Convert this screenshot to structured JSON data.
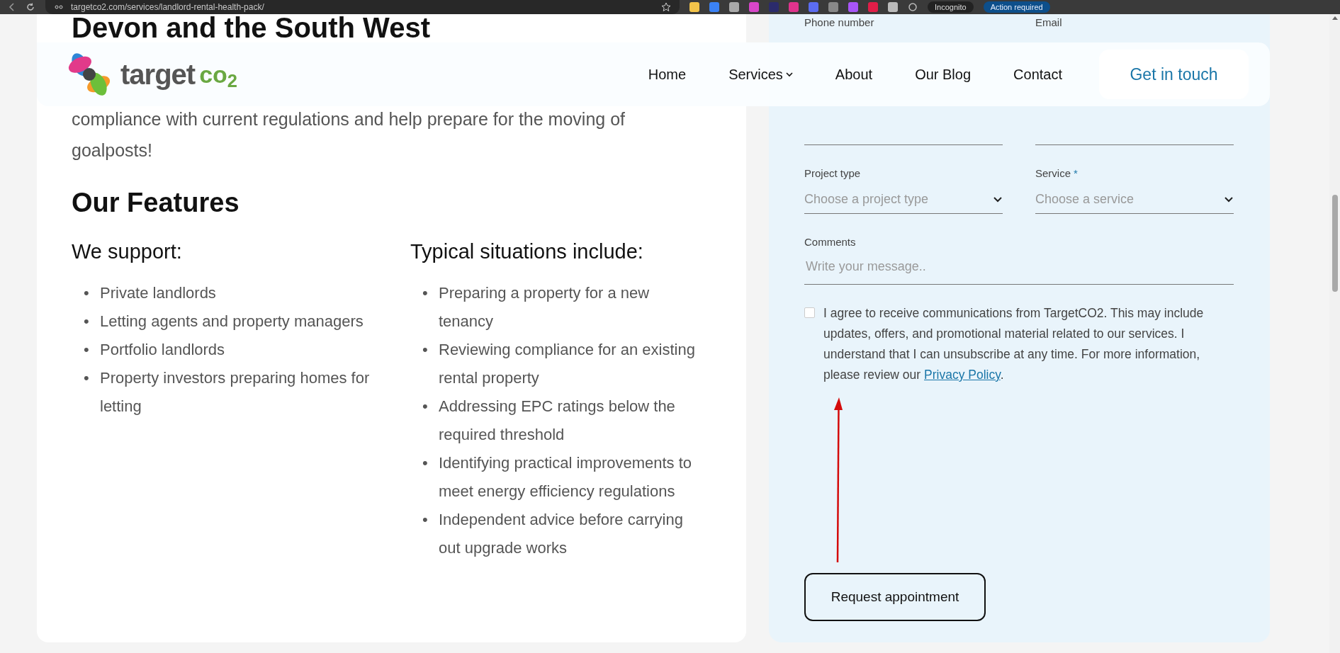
{
  "browser": {
    "url": "targetco2.com/services/landlord-rental-health-pack/",
    "profile": "Incognito",
    "action": "Action required"
  },
  "header": {
    "logo": {
      "word": "target",
      "mark": "co$_{2}$"
    },
    "nav": [
      {
        "label": "Home",
        "kind": "link"
      },
      {
        "label": "Services",
        "kind": "dropdown"
      },
      {
        "label": "About",
        "kind": "link"
      },
      {
        "label": "Our Blog",
        "kind": "link"
      },
      {
        "label": "Contact",
        "kind": "link"
      }
    ],
    "cta": "Get in touch"
  },
  "article": {
    "heading": "Devon and the South West",
    "paragraph": "compliance with current regulations and help prepare for the moving of goalposts!",
    "features_heading": "Our Features",
    "columns": [
      {
        "heading": "We support:",
        "bullet": "•",
        "items": [
          "Private landlords",
          "Letting agents and property managers",
          "Portfolio landlords",
          "Property investors preparing homes for letting"
        ]
      },
      {
        "heading": "Typical situations include:",
        "bullet": "•",
        "items": [
          "Preparing a property for a new tenancy",
          "Reviewing compliance for an existing rental property",
          "Addressing EPC ratings below the required threshold",
          "Identifying practical improvements to meet energy efficiency regulations",
          "Independent advice before carrying out upgrade works"
        ]
      }
    ]
  },
  "form": {
    "fields": [
      {
        "kind": "text",
        "label": "Phone number"
      },
      {
        "kind": "text",
        "label": "Email"
      },
      {
        "kind": "select",
        "label": "Project type",
        "placeholder": "Choose a project type"
      },
      {
        "kind": "select",
        "label": "Service",
        "required_mark": "*",
        "placeholder": "Choose a service"
      },
      {
        "kind": "textarea",
        "label": "Comments",
        "placeholder": "Write your message.."
      }
    ],
    "consent": {
      "checked": false,
      "text": "I agree to receive communications from TargetCO2. This may include updates, offers, and promotional material related to our services. I understand that I can unsubscribe at any time. For more information, please review our ",
      "link": "Privacy Policy",
      "after": "."
    },
    "submit": "Request appointment"
  }
}
